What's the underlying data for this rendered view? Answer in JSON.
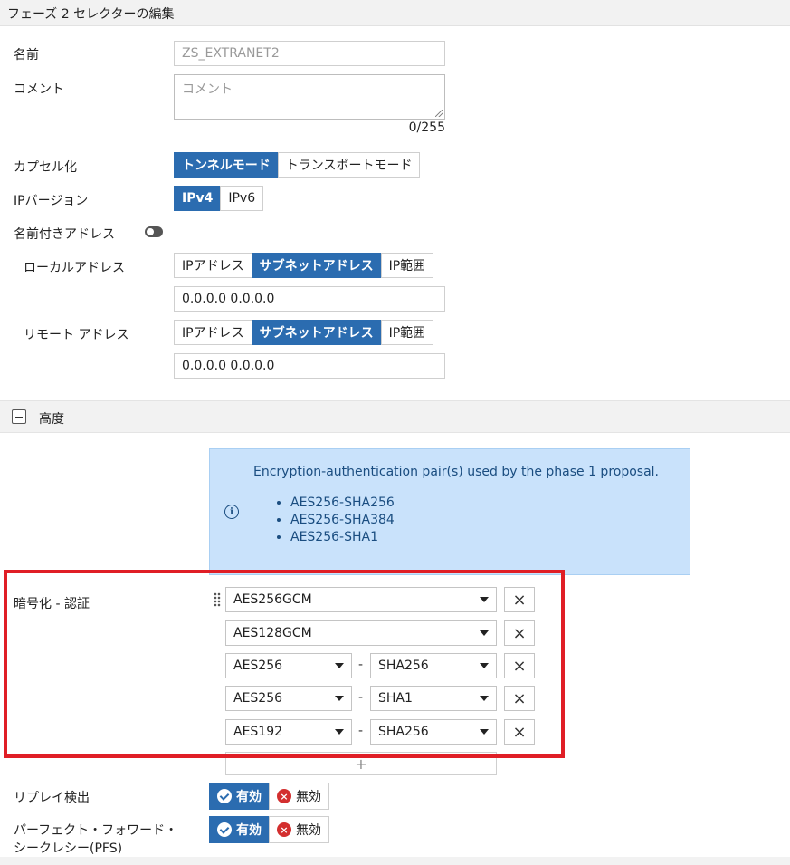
{
  "title": "フェーズ 2 セレクターの編集",
  "name": {
    "label": "名前",
    "value": "ZS_EXTRANET2"
  },
  "comment": {
    "label": "コメント",
    "placeholder": "コメント",
    "counter": "0/255"
  },
  "encapsulation": {
    "label": "カプセル化",
    "options": [
      "トンネルモード",
      "トランスポートモード"
    ],
    "selected": "トンネルモード"
  },
  "ip_version": {
    "label": "IPバージョン",
    "options": [
      "IPv4",
      "IPv6"
    ],
    "selected": "IPv4"
  },
  "named_address": {
    "label": "名前付きアドレス",
    "enabled": false
  },
  "local_address": {
    "label": "ローカルアドレス",
    "options": [
      "IPアドレス",
      "サブネットアドレス",
      "IP範囲"
    ],
    "selected": "サブネットアドレス",
    "value": "0.0.0.0 0.0.0.0"
  },
  "remote_address": {
    "label": "リモート アドレス",
    "options": [
      "IPアドレス",
      "サブネットアドレス",
      "IP範囲"
    ],
    "selected": "サブネットアドレス",
    "value": "0.0.0.0 0.0.0.0"
  },
  "advanced": {
    "label": "高度"
  },
  "info": {
    "text": "Encryption-authentication pair(s) used by the phase 1 proposal.",
    "items": [
      "AES256-SHA256",
      "AES256-SHA384",
      "AES256-SHA1"
    ]
  },
  "enc_auth": {
    "label": "暗号化 - 認証",
    "rows": [
      {
        "enc": "AES256GCM",
        "auth": ""
      },
      {
        "enc": "AES128GCM",
        "auth": ""
      },
      {
        "enc": "AES256",
        "auth": "SHA256"
      },
      {
        "enc": "AES256",
        "auth": "SHA1"
      },
      {
        "enc": "AES192",
        "auth": "SHA256"
      }
    ],
    "add_symbol": "+",
    "separator": "-"
  },
  "replay": {
    "label": "リプレイ検出",
    "on_label": "有効",
    "off_label": "無効",
    "selected": "有効"
  },
  "pfs": {
    "label_line1": "パーフェクト・フォワード・",
    "label_line2": "シークレシー(PFS)",
    "on_label": "有効",
    "off_label": "無効",
    "selected": "有効"
  },
  "colors": {
    "accent": "#2b6cb0",
    "highlight_border": "#e01e26",
    "info_bg": "#c9e2fb",
    "error": "#d32f2f"
  }
}
